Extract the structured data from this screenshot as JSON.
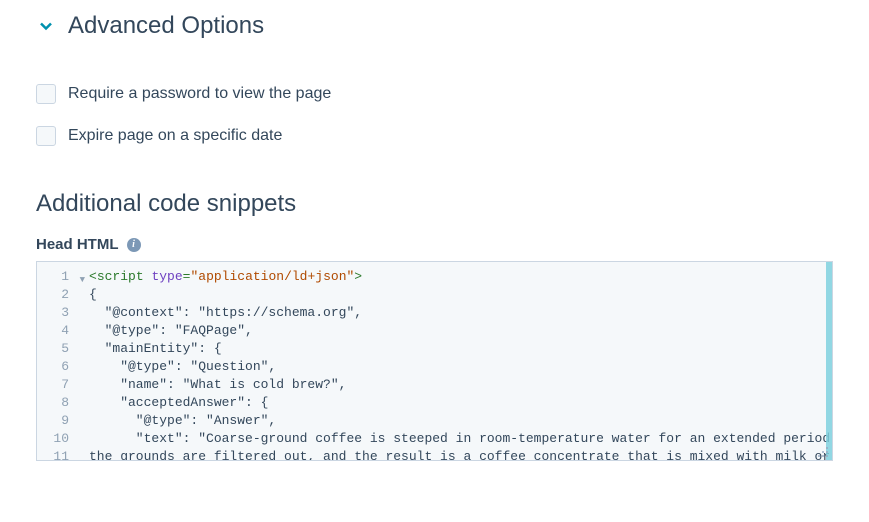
{
  "accordion": {
    "title": "Advanced Options"
  },
  "checkboxes": {
    "require_password": "Require a password to view the page",
    "expire_page": "Expire page on a specific date"
  },
  "section": {
    "snippets_heading": "Additional code snippets",
    "head_html_label": "Head HTML"
  },
  "editor": {
    "lines": [
      {
        "n": 1,
        "type": "open_tag",
        "tag": "script",
        "attr": "type",
        "val": "\"application/ld+json\"",
        "fold": true
      },
      {
        "n": 2,
        "type": "plain",
        "text": "{"
      },
      {
        "n": 3,
        "type": "plain",
        "text": "  \"@context\": \"https://schema.org\","
      },
      {
        "n": 4,
        "type": "plain",
        "text": "  \"@type\": \"FAQPage\","
      },
      {
        "n": 5,
        "type": "plain",
        "text": "  \"mainEntity\": {"
      },
      {
        "n": 6,
        "type": "plain",
        "text": "    \"@type\": \"Question\","
      },
      {
        "n": 7,
        "type": "plain",
        "text": "    \"name\": \"What is cold brew?\","
      },
      {
        "n": 8,
        "type": "plain",
        "text": "    \"acceptedAnswer\": {"
      },
      {
        "n": 9,
        "type": "plain",
        "text": "      \"@type\": \"Answer\","
      },
      {
        "n": 10,
        "type": "plain",
        "text": "      \"text\": \"Coarse-ground coffee is steeped in room-temperature water for an extended period of time,"
      },
      {
        "n": 11,
        "type": "plain",
        "text": "the grounds are filtered out, and the result is a coffee concentrate that is mixed with milk or water"
      }
    ]
  }
}
